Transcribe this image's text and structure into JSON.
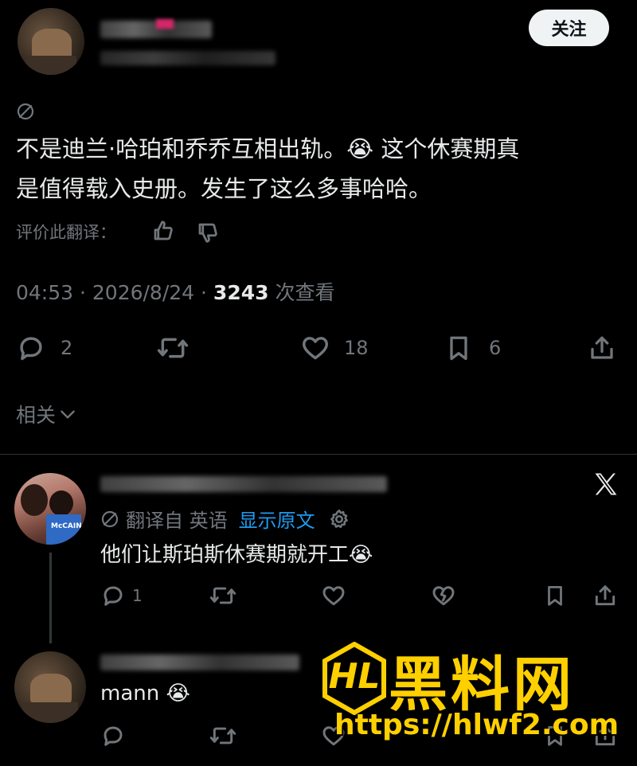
{
  "header": {
    "follow_label": "关注"
  },
  "tweet": {
    "text_line1": "不是迪兰·哈珀和乔乔互相出轨。😭 这个休赛期真",
    "text_line2": "是值得载入史册。发生了这么多事哈哈。",
    "rate_translation_label": "评价此翻译：",
    "meta_time": "04:53 · 2026/8/24 · ",
    "views_count": "3243",
    "views_label": " 次查看",
    "replies": "2",
    "likes": "18",
    "bookmarks": "6"
  },
  "related": {
    "label": "相关"
  },
  "reply1": {
    "translated_from": "翻译自 英语",
    "show_original": "显示原文",
    "text": "他们让斯珀斯休赛期就开工😭",
    "replies": "1",
    "avatar_jersey": "McCAIN"
  },
  "reply2": {
    "text": "mann 😭"
  },
  "watermark": {
    "title": "黑料网",
    "url": "https://hlwf2.com",
    "logo_text": "HL"
  },
  "colors": {
    "background": "#000000",
    "text": "#e7e9ea",
    "muted": "#71767b",
    "link": "#1d9bf0",
    "watermark": "#ffd000"
  }
}
